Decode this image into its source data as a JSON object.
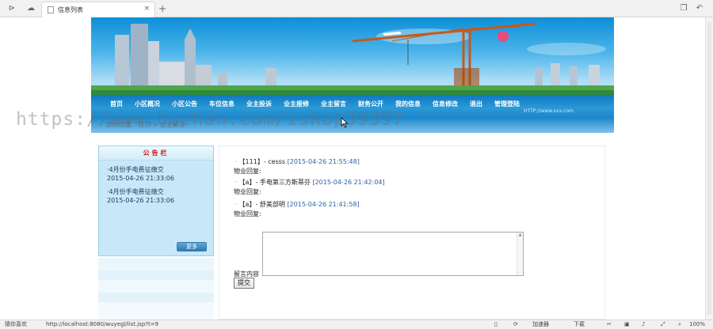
{
  "browser": {
    "tab_title": "信息列表",
    "tab_close": "×",
    "new_tab": "+"
  },
  "nav": {
    "items": [
      "首页",
      "小区概况",
      "小区公告",
      "车位信息",
      "业主投诉",
      "业主报修",
      "业主留言",
      "财务公开",
      "我的信息",
      "信息修改",
      "退出",
      "管理登陆"
    ],
    "subline": "HTTP://www.xxx.com"
  },
  "breadcrumb": "您的位置：首页 > 业主留言",
  "notice": {
    "title": "公告栏",
    "items": [
      {
        "title": "·4月份手电费征缴交",
        "date": "2015-04-26 21:33:06"
      },
      {
        "title": "·4月份手电费征缴交",
        "date": "2015-04-26 21:33:06"
      }
    ],
    "more_label": "更多"
  },
  "messages": [
    {
      "bullet": "·",
      "text": "【111】- cesss",
      "time": "[2015-04-26 21:55:48]",
      "reply_label": "物业回复:"
    },
    {
      "bullet": "·",
      "text": "【a】- 手电第三方斯蒂芬",
      "time": "[2015-04-26 21:42:04]",
      "reply_label": "物业回复:"
    },
    {
      "bullet": "·",
      "text": "【a】- 舒美部明",
      "time": "[2015-04-26 21:41:58]",
      "reply_label": "物业回复:"
    }
  ],
  "form": {
    "message_label": "留言内容",
    "submit_label": "提交"
  },
  "watermark": "https://www.huzhan.com/ishop39397",
  "status": {
    "left": "猜你喜欢",
    "url": "http://localhost:8080/wuyegl/list.jsp?t=9",
    "accelerator": "加速器",
    "download": "下载",
    "zoom": "100%"
  }
}
